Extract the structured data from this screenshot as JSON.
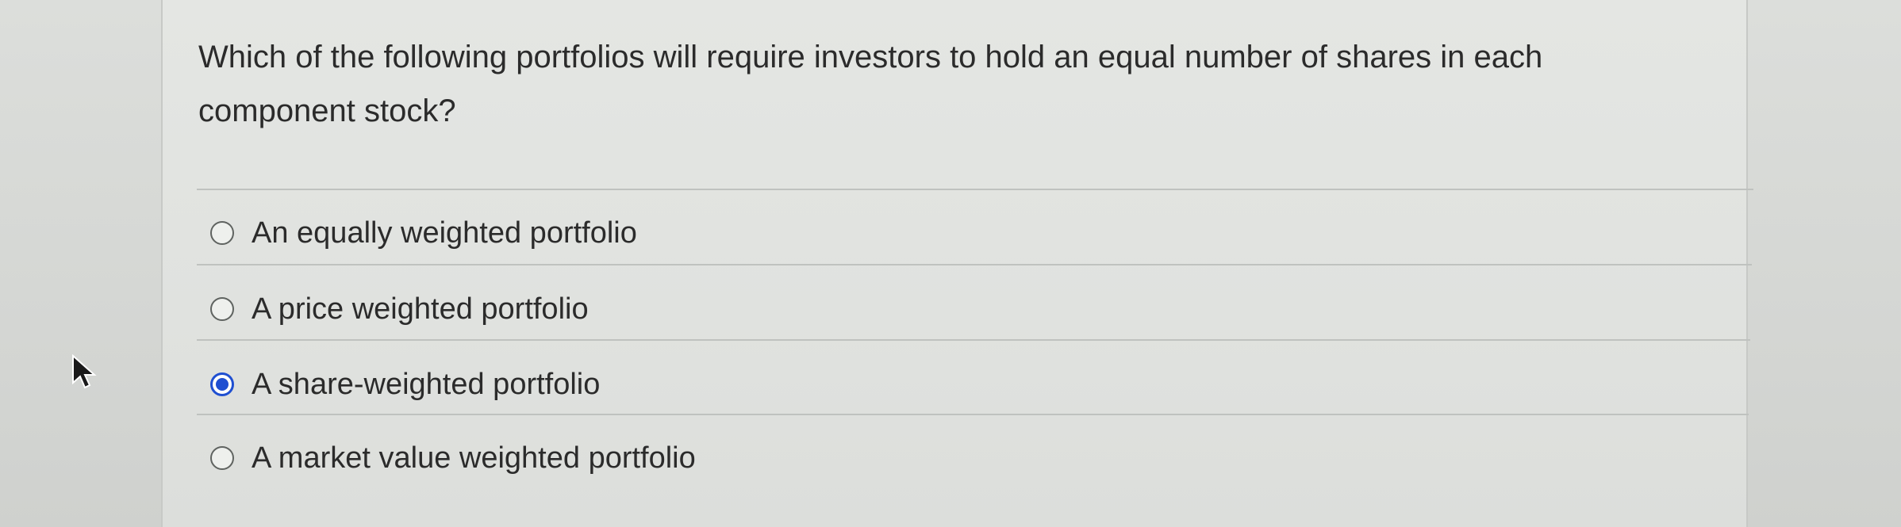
{
  "question": {
    "line1": "Which of the following portfolios will require investors to hold an equal number of shares in each",
    "line2": "component stock?"
  },
  "options": [
    {
      "label": "An equally weighted portfolio",
      "selected": false
    },
    {
      "label": "A price weighted portfolio",
      "selected": false
    },
    {
      "label": "A share-weighted portfolio",
      "selected": true
    },
    {
      "label": "A market value weighted portfolio",
      "selected": false
    }
  ],
  "colors": {
    "accent": "#1f4fd1",
    "text": "#2b2b2b",
    "background": "#e0e2df"
  },
  "icons": {
    "cursor": "mouse-pointer-icon",
    "radio": "radio-button-icon"
  }
}
